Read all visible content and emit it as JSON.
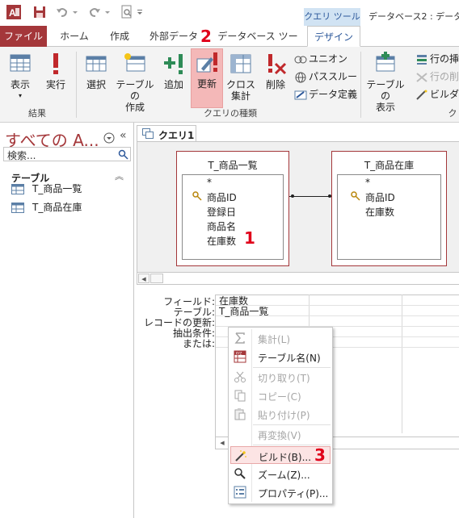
{
  "title_bar": {
    "context_tab": "クエリ ツール",
    "app_title": "データベース2 : データベ"
  },
  "tabs": [
    {
      "label": "ファイル"
    },
    {
      "label": "ホーム"
    },
    {
      "label": "作成"
    },
    {
      "label": "外部データ"
    },
    {
      "label": "データベース ツール"
    },
    {
      "label": "デザイン"
    }
  ],
  "ribbon": {
    "results": {
      "view_label": "表示",
      "run_label": "実行",
      "group_label": "結果"
    },
    "query_type": {
      "select_label": "選択",
      "make_table_line1": "テーブルの",
      "make_table_line2": "作成",
      "append_label": "追加",
      "update_label": "更新",
      "crosstab_line1": "クロス",
      "crosstab_line2": "集計",
      "delete_label": "削除",
      "union_label": "ユニオン",
      "passthrough_label": "パススルー",
      "data_def_label": "データ定義",
      "group_label": "クエリの種類"
    },
    "setup": {
      "show_table_line1": "テーブルの",
      "show_table_line2": "表示",
      "insert_rows_label": "行の挿",
      "delete_rows_label": "行の削",
      "builder_label": "ビルダー",
      "group_label_partial": "ク"
    }
  },
  "nav_pane": {
    "title": "すべての A...",
    "search_placeholder": "検索...",
    "section_label": "テーブル",
    "items": [
      {
        "label": "T_商品一覧"
      },
      {
        "label": "T_商品在庫"
      }
    ]
  },
  "document": {
    "tab_label": "クエリ1",
    "tables": [
      {
        "title": "T_商品一覧",
        "fields": [
          "*",
          "商品ID",
          "登録日",
          "商品名",
          "在庫数"
        ]
      },
      {
        "title": "T_商品在庫",
        "fields": [
          "*",
          "商品ID",
          "在庫数"
        ]
      }
    ],
    "grid_row_labels": [
      "フィールド:",
      "テーブル:",
      "レコードの更新:",
      "抽出条件:",
      "または:"
    ],
    "grid_values": {
      "field": "在庫数",
      "table": "T_商品一覧"
    }
  },
  "context_menu": {
    "items": [
      {
        "label": "集計(L)",
        "icon": "sigma-icon",
        "disabled": true
      },
      {
        "label": "テーブル名(N)",
        "icon": "table-name-icon",
        "disabled": false
      },
      {
        "label": "切り取り(T)",
        "icon": "scissors-icon",
        "disabled": true
      },
      {
        "label": "コピー(C)",
        "icon": "copy-icon",
        "disabled": true
      },
      {
        "label": "貼り付け(P)",
        "icon": "paste-icon",
        "disabled": true
      },
      {
        "label": "再変換(V)",
        "icon": "",
        "disabled": true
      },
      {
        "label": "ビルド(B)...",
        "icon": "wand-icon",
        "disabled": false,
        "highlighted": true
      },
      {
        "label": "ズーム(Z)...",
        "icon": "magnifier-icon",
        "disabled": false
      },
      {
        "label": "プロパティ(P)...",
        "icon": "properties-icon",
        "disabled": false
      }
    ]
  },
  "annotations": {
    "step1": "1",
    "step2": "2",
    "step3": "3"
  },
  "colors": {
    "access_red": "#a4373a",
    "ribbon_bg": "#f3f3f3",
    "context_tab_bg": "#d1e3f3",
    "selected_button_bg": "#f4b8b8",
    "annotation_red": "#e0001a"
  }
}
